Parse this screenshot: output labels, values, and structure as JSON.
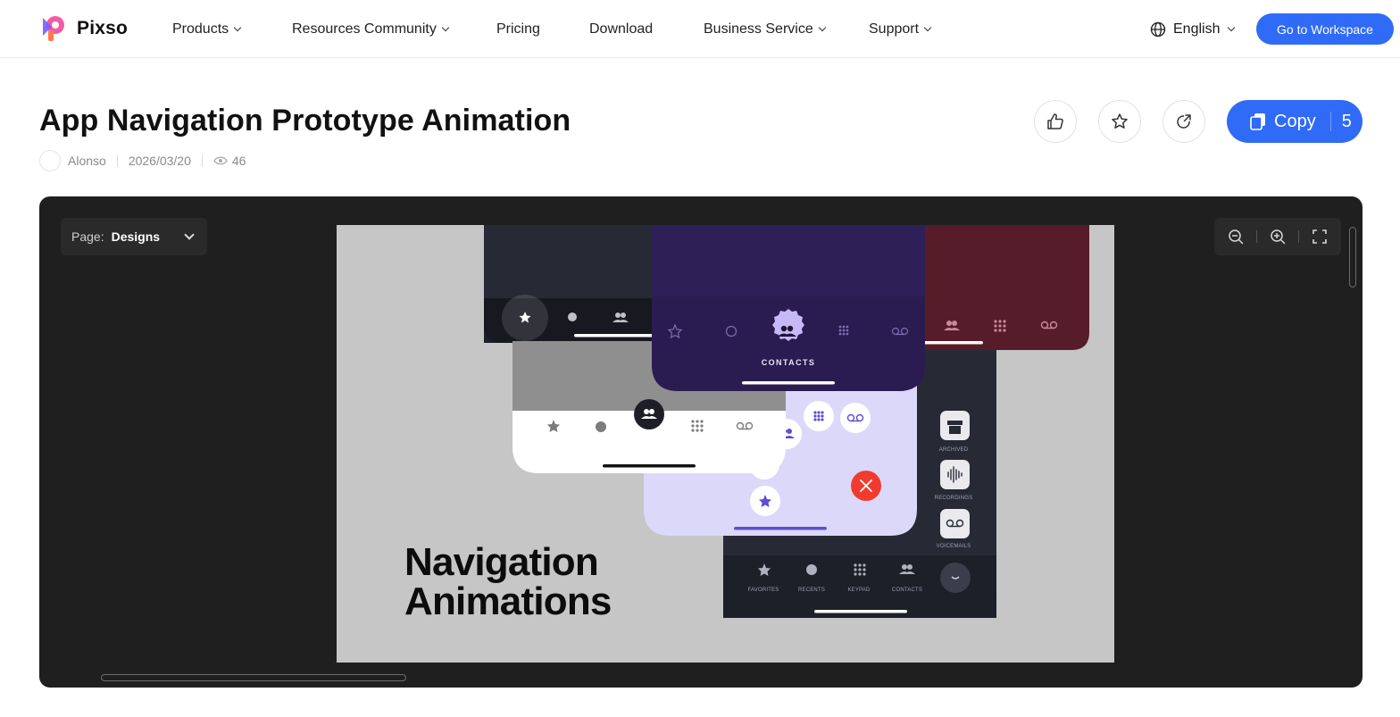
{
  "brand": {
    "name": "Pixso"
  },
  "nav": {
    "items": [
      {
        "label": "Products",
        "has_dropdown": true
      },
      {
        "label": "Resources Community",
        "has_dropdown": true
      },
      {
        "label": "Pricing",
        "has_dropdown": false
      },
      {
        "label": "Download",
        "has_dropdown": false
      },
      {
        "label": "Business Service",
        "has_dropdown": true
      },
      {
        "label": "Support",
        "has_dropdown": true
      }
    ],
    "language": "English",
    "workspace_button": "Go to Workspace"
  },
  "file": {
    "title": "App Navigation Prototype Animation",
    "author": "Alonso",
    "date": "2026/03/20",
    "views": "46"
  },
  "actions": {
    "copy_label": "Copy",
    "copy_count": "5"
  },
  "viewer": {
    "page_label": "Page:",
    "page_value": "Designs"
  },
  "artwork": {
    "headline_line1": "Navigation",
    "headline_line2": "Animations",
    "contacts_label": "CONTACTS",
    "side_labels": [
      "ARCHIVED",
      "RECORDINGS",
      "VOICEMAILS"
    ],
    "tab_labels": [
      "FAVORITES",
      "RECENTS",
      "KEYPAD",
      "CONTACTS"
    ]
  },
  "colors": {
    "accent": "#2f6bf6",
    "viewer_bg": "#1f1f1f",
    "artboard_bg": "#c6c6c6",
    "purple_phone": "#2e1f57",
    "maroon_phone": "#571c2a",
    "lavender_phone": "#dcd8f9",
    "close_red": "#f23b2f"
  }
}
